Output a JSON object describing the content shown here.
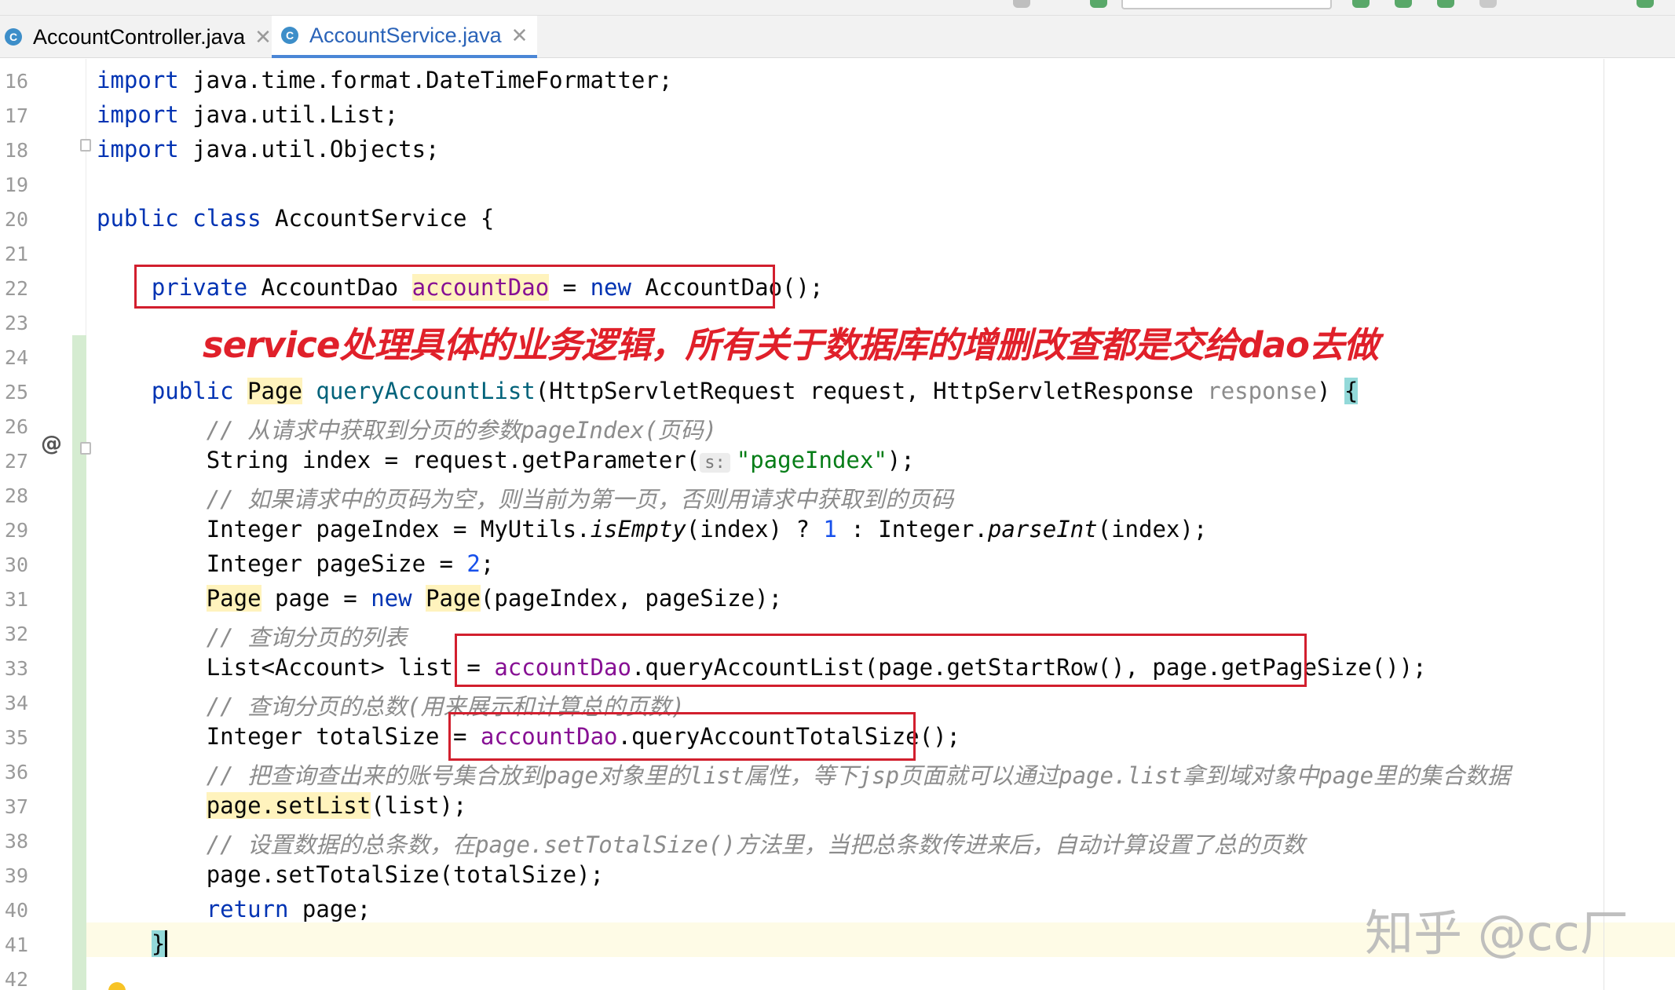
{
  "tabs": [
    {
      "label": "AccountController.java",
      "icon": "class-icon"
    },
    {
      "label": "AccountService.java",
      "icon": "class-icon",
      "active": true
    }
  ],
  "line_numbers": [
    "16",
    "17",
    "18",
    "19",
    "20",
    "21",
    "22",
    "23",
    "24",
    "25",
    "26",
    "27",
    "28",
    "29",
    "30",
    "31",
    "32",
    "33",
    "34",
    "35",
    "36",
    "37",
    "38",
    "39",
    "40",
    "41",
    "42"
  ],
  "code": {
    "l16": {
      "kw": "import",
      "rest": " java.time.format.DateTimeFormatter;"
    },
    "l17": {
      "kw": "import",
      "rest": " java.util.List;"
    },
    "l18": {
      "kw": "import",
      "rest": " java.util.Objects;"
    },
    "l20": {
      "kw1": "public",
      "kw2": "class",
      "rest": " AccountService {"
    },
    "l22": {
      "kw1": "private",
      "t1": " AccountDao ",
      "field": "accountDao",
      "t2": " = ",
      "kw2": "new",
      "t3": " AccountDao();"
    },
    "l25": {
      "kw": "public",
      "type": "Page",
      "method": "queryAccountList",
      "t1": "(HttpServletRequest request, HttpServletResponse ",
      "param": "response",
      "t2": ") ",
      "brace": "{"
    },
    "l26": {
      "comment": "// 从请求中获取到分页的参数pageIndex(页码)"
    },
    "l27": {
      "t1": "String index = request.getParameter(",
      "hint": "s:",
      "str": "\"pageIndex\"",
      "t2": ");"
    },
    "l28": {
      "comment": "// 如果请求中的页码为空，则当前为第一页，否则用请求中获取到的页码"
    },
    "l29": {
      "t1": "Integer pageIndex = MyUtils.",
      "m1": "isEmpty",
      "t2": "(index) ? ",
      "n1": "1",
      "t3": " : Integer.",
      "m2": "parseInt",
      "t4": "(index);"
    },
    "l30": {
      "t1": "Integer pageSize = ",
      "n1": "2",
      "t2": ";"
    },
    "l31": {
      "type1": "Page",
      "t1": " page = ",
      "kw": "new",
      "t2": " ",
      "type2": "Page",
      "t3": "(pageIndex, pageSize);"
    },
    "l32": {
      "comment": "// 查询分页的列表"
    },
    "l33": {
      "t1": "List<Account> list = ",
      "field": "accountDao",
      "t2": ".queryAccountList(page.getStartRow(), page.getPageSize());"
    },
    "l34": {
      "comment": "// 查询分页的总数(用来展示和计算总的页数)"
    },
    "l35": {
      "t1": "Integer totalSize = ",
      "field": "accountDao",
      "t2": ".queryAccountTotalSize();"
    },
    "l36": {
      "comment": "// 把查询查出来的账号集合放到page对象里的list属性，等下jsp页面就可以通过page.list拿到域对象中page里的集合数据"
    },
    "l37": {
      "hl": "page.setList",
      "t1": "(list);"
    },
    "l38": {
      "comment": "// 设置数据的总条数，在page.setTotalSize()方法里，当把总条数传进来后，自动计算设置了总的页数"
    },
    "l39": {
      "t1": "page.setTotalSize(totalSize);"
    },
    "l40": {
      "kw": "return",
      "t1": " page;"
    },
    "l41": {
      "brace": "}"
    }
  },
  "annotation": "service处理具体的业务逻辑，所有关于数据库的增删改查都是交给dao去做",
  "watermark": "知乎 @cc厂",
  "colors": {
    "keyword": "#0033b3",
    "field": "#871094",
    "method": "#00627a",
    "string": "#067d17",
    "comment": "#8c8c8c",
    "annotation_red": "#d21f2e"
  }
}
